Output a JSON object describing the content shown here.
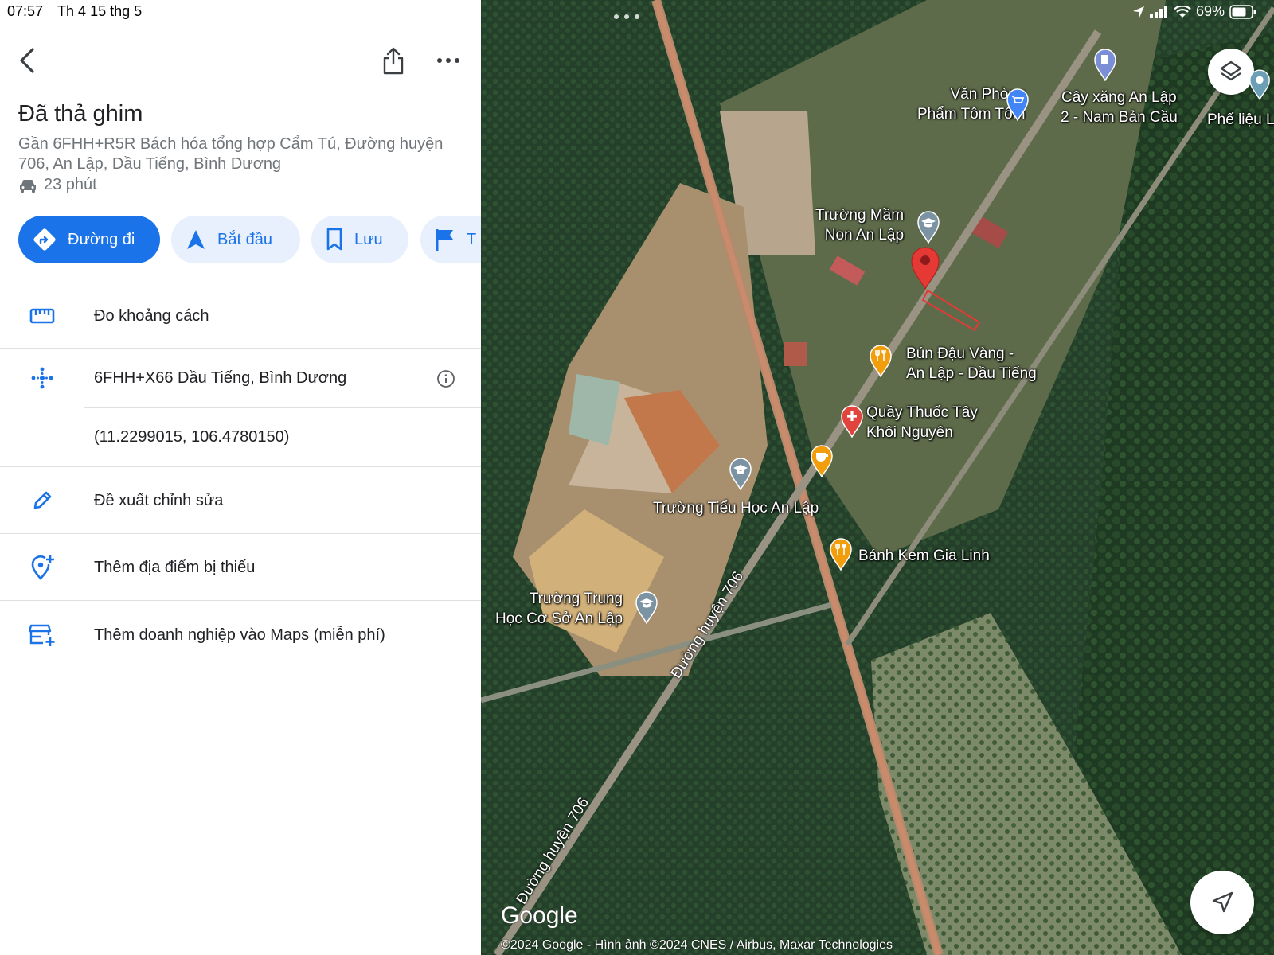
{
  "status": {
    "time": "07:57",
    "date": "Th 4 15 thg 5",
    "battery": "69%"
  },
  "place": {
    "title": "Đã thả ghim",
    "address": "Gần 6FHH+R5R Bách hóa tổng hợp Cẩm Tú, Đường huyện 706, An Lập, Dầu Tiếng, Bình Dương",
    "drive_time": "23 phút"
  },
  "actions": [
    {
      "label": "Đường đi",
      "icon": "directions-icon"
    },
    {
      "label": "Bắt đầu",
      "icon": "navigation-arrow-icon"
    },
    {
      "label": "Lưu",
      "icon": "bookmark-icon"
    },
    {
      "label": "T",
      "icon": "flag-icon"
    }
  ],
  "details": {
    "measure": "Đo khoảng cách",
    "plus_code": "6FHH+X66 Dầu Tiếng, Bình Dương",
    "coordinates": "(11.2299015, 106.4780150)",
    "suggest_edit": "Đề xuất chỉnh sửa",
    "add_missing": "Thêm địa điểm bị thiếu",
    "add_business": "Thêm doanh nghiệp vào Maps (miễn phí)"
  },
  "map": {
    "pois": {
      "van_phong": "Văn Phòng\nPhẩm Tôm Tôm",
      "cay_xang": "Cây xăng An Lập\n2 - Nam Bản Cầu",
      "phe_lieu": "Phế liệu L",
      "mam_non": "Trường Mầm\nNon An Lập",
      "bun_dau": "Bún Đậu Vàng -\nAn Lập - Dầu Tiếng",
      "quay_thuoc": "Quầy Thuốc Tây\nKhôi Nguyên",
      "tieu_hoc": "Trường Tiểu Học An Lập",
      "banh_kem": "Bánh Kem Gia Linh",
      "thcs": "Trường Trung\nHọc Cơ Sở An Lập"
    },
    "road_label": "Đường huyện 706",
    "logo": "Google",
    "attribution": "©2024 Google - Hình ảnh ©2024 CNES / Airbus, Maxar Technologies"
  }
}
